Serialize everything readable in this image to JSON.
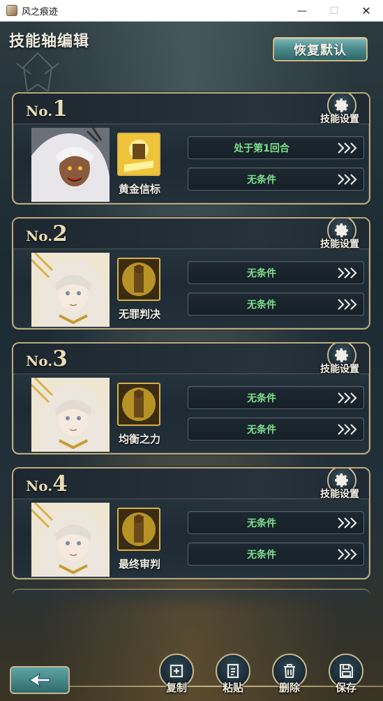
{
  "window": {
    "title": "风之痕迹",
    "minimize": "—",
    "maximize": "☐",
    "close": "✕"
  },
  "header": {
    "title": "技能轴编辑",
    "reset_label": "恢复默认"
  },
  "cards": [
    {
      "no_prefix": "No.",
      "no_num": "1",
      "settings_label": "技能设置",
      "skill_name": "黄金信标",
      "conditions": [
        "处于第1回合",
        "无条件"
      ]
    },
    {
      "no_prefix": "No.",
      "no_num": "2",
      "settings_label": "技能设置",
      "skill_name": "无罪判决",
      "conditions": [
        "无条件",
        "无条件"
      ]
    },
    {
      "no_prefix": "No.",
      "no_num": "3",
      "settings_label": "技能设置",
      "skill_name": "均衡之力",
      "conditions": [
        "无条件",
        "无条件"
      ]
    },
    {
      "no_prefix": "No.",
      "no_num": "4",
      "settings_label": "技能设置",
      "skill_name": "最终审判",
      "conditions": [
        "无条件",
        "无条件"
      ]
    }
  ],
  "actions": {
    "copy": "复制",
    "paste": "粘贴",
    "delete": "删除",
    "save": "保存"
  },
  "colors": {
    "condition_text": "#7de08a",
    "frame_gold": "#c7b88f",
    "accent_teal": "#4d8c8f"
  }
}
